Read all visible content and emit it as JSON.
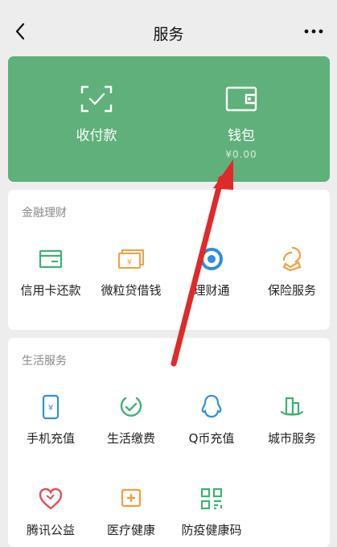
{
  "header": {
    "title": "服务",
    "back_icon": "chevron-left-icon",
    "more_icon": "more-dots-icon"
  },
  "wallet_card": {
    "color": "#5fb07a",
    "items": [
      {
        "label": "收付款",
        "icon": "scan-pay-icon"
      },
      {
        "label": "钱包",
        "icon": "wallet-icon",
        "balance": "¥0.00"
      }
    ]
  },
  "finance": {
    "title": "金融理财",
    "items": [
      {
        "label": "信用卡还款",
        "icon": "credit-card-icon"
      },
      {
        "label": "微粒贷借钱",
        "icon": "loan-icon"
      },
      {
        "label": "理财通",
        "icon": "wealth-icon"
      },
      {
        "label": "保险服务",
        "icon": "insurance-icon"
      }
    ]
  },
  "life": {
    "title": "生活服务",
    "items": [
      {
        "label": "手机充值",
        "icon": "phone-topup-icon"
      },
      {
        "label": "生活缴费",
        "icon": "utility-bill-icon"
      },
      {
        "label": "Q币充值",
        "icon": "qcoin-icon"
      },
      {
        "label": "城市服务",
        "icon": "city-service-icon"
      },
      {
        "label": "腾讯公益",
        "icon": "charity-heart-icon"
      },
      {
        "label": "医疗健康",
        "icon": "medical-icon"
      },
      {
        "label": "防疫健康码",
        "icon": "health-code-icon"
      }
    ]
  },
  "annotation": {
    "arrow_color": "#e03030"
  }
}
